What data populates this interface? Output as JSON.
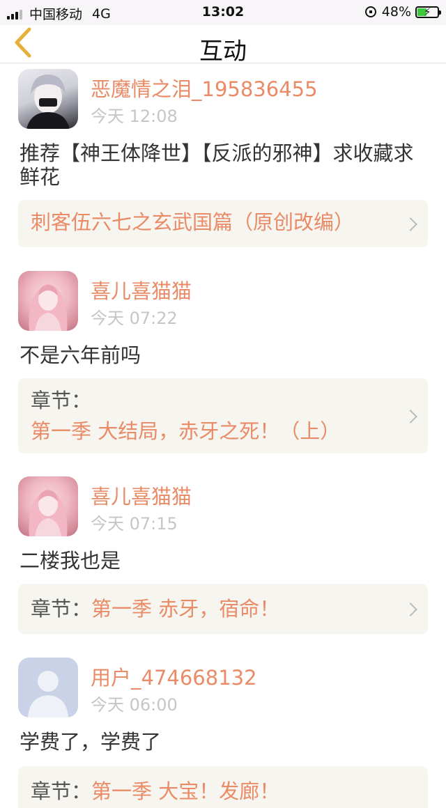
{
  "status_bar": {
    "carrier": "中国移动",
    "network": "4G",
    "time": "13:02",
    "battery_percent": "48%",
    "battery_level": 0.48
  },
  "nav": {
    "title": "互动"
  },
  "colors": {
    "accent": "#e98b67",
    "muted": "#c6c6c6",
    "card_bg": "#f6f5f0"
  },
  "posts": [
    {
      "username": "恶魔情之泪_195836455",
      "time": "今天 12:08",
      "content": "推荐【神王体降世】【反派的邪神】求收藏求鲜花",
      "card": {
        "prefix": "",
        "title": "刺客伍六七之玄武国篇（原创改编）"
      },
      "avatar": "anime-boy-avatar"
    },
    {
      "username": "喜儿喜猫猫",
      "time": "今天 07:22",
      "content": "不是六年前吗",
      "card": {
        "prefix": "章节：",
        "title": "第一季  大结局，赤牙之死！（上）"
      },
      "avatar": "anime-girl-avatar"
    },
    {
      "username": "喜儿喜猫猫",
      "time": "今天 07:15",
      "content": "二楼我也是",
      "card": {
        "prefix": "章节：",
        "title": "第一季  赤牙，宿命！"
      },
      "avatar": "anime-girl-avatar"
    },
    {
      "username": "用户_474668132",
      "time": "今天 06:00",
      "content": "学费了，学费了",
      "card": {
        "prefix": "章节：",
        "title": "第一季  大宝！发廊！"
      },
      "avatar": "default-user-avatar"
    }
  ]
}
